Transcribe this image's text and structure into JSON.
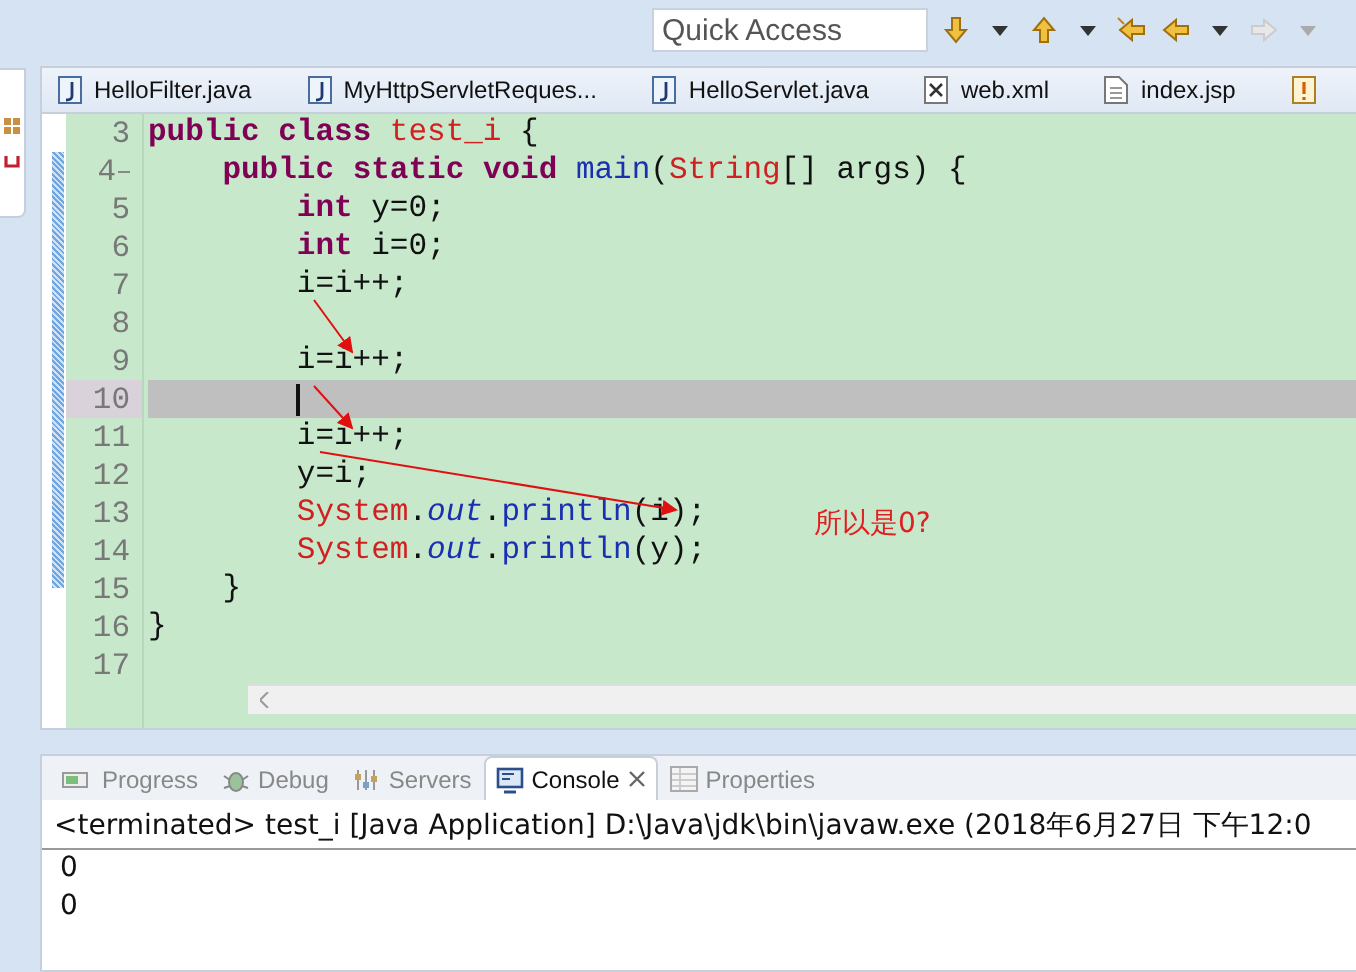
{
  "toolbar": {
    "quick_access": {
      "placeholder": "Quick Access"
    }
  },
  "editor": {
    "tabs": [
      {
        "label": "HelloFilter.java",
        "kind": "java",
        "selected": false
      },
      {
        "label": "MyHttpServletReques...",
        "kind": "java",
        "selected": false
      },
      {
        "label": "HelloServlet.java",
        "kind": "java",
        "selected": false
      },
      {
        "label": "web.xml",
        "kind": "xml",
        "selected": false
      },
      {
        "label": "index.jsp",
        "kind": "file",
        "selected": false
      },
      {
        "kind": "warning",
        "selected": false
      }
    ],
    "lines": [
      {
        "number": "3",
        "selected": false,
        "tokens": [
          {
            "kind": "keyword",
            "text": "public"
          },
          {
            "kind": "keyword",
            "text": " class"
          },
          {
            "kind": "type",
            "text": " test_i"
          },
          {
            "kind": "plain",
            "text": " {"
          }
        ],
        "children": [
          {
            "number": "4",
            "selected": false,
            "folding": true,
            "tokens": [
              {
                "kind": "keyword",
                "text": "public"
              },
              {
                "kind": "keyword",
                "text": " static"
              },
              {
                "kind": "keyword",
                "text": " void"
              },
              {
                "kind": "method",
                "text": " main"
              },
              {
                "kind": "plain",
                "text": "("
              },
              {
                "kind": "type",
                "text": "String"
              },
              {
                "kind": "plain",
                "text": "[] args) {"
              }
            ],
            "children": [
              {
                "number": "5",
                "selected": false,
                "tokens": [
                  {
                    "kind": "keyword",
                    "text": "int"
                  },
                  {
                    "kind": "plain",
                    "text": " y=0;"
                  }
                ]
              },
              {
                "number": "6",
                "selected": false,
                "tokens": [
                  {
                    "kind": "keyword",
                    "text": "int"
                  },
                  {
                    "kind": "plain",
                    "text": " i=0;"
                  }
                ]
              },
              {
                "number": "7",
                "selected": false,
                "tokens": [
                  {
                    "kind": "plain",
                    "text": "i=i++;"
                  }
                ]
              },
              {
                "number": "8",
                "selected": false
              },
              {
                "number": "9",
                "selected": false,
                "tokens": [
                  {
                    "kind": "plain",
                    "text": "i=i++;"
                  }
                ]
              },
              {
                "number": "10",
                "selected": true
              },
              {
                "number": "11",
                "selected": false,
                "tokens": [
                  {
                    "kind": "plain",
                    "text": "i=i++;"
                  }
                ]
              },
              {
                "number": "12",
                "selected": false,
                "tokens": [
                  {
                    "kind": "plain",
                    "text": "y=i;"
                  }
                ]
              },
              {
                "number": "13",
                "selected": false,
                "tokens": [
                  {
                    "kind": "type",
                    "text": "System"
                  },
                  {
                    "kind": "plain",
                    "text": "."
                  },
                  {
                    "kind": "static",
                    "text": "out"
                  },
                  {
                    "kind": "plain",
                    "text": "."
                  },
                  {
                    "kind": "method",
                    "text": "println"
                  },
                  {
                    "kind": "plain",
                    "text": "(i);"
                  }
                ]
              },
              {
                "number": "14",
                "selected": false,
                "tokens": [
                  {
                    "kind": "type",
                    "text": "System"
                  },
                  {
                    "kind": "plain",
                    "text": "."
                  },
                  {
                    "kind": "static",
                    "text": "out"
                  },
                  {
                    "kind": "plain",
                    "text": "."
                  },
                  {
                    "kind": "method",
                    "text": "println"
                  },
                  {
                    "kind": "plain",
                    "text": "(y);"
                  }
                ]
              }
            ]
          },
          {
            "number": "15",
            "selected": false,
            "tokens": [
              {
                "kind": "plain",
                "text": "}"
              }
            ]
          }
        ]
      },
      {
        "number": "16",
        "selected": false,
        "tokens": [
          {
            "kind": "plain",
            "text": "}"
          }
        ]
      },
      {
        "number": "17",
        "selected": false
      }
    ],
    "annotation": "所以是0?"
  },
  "console": {
    "tabs": [
      {
        "label": "Progress",
        "kind": "progress",
        "selected": false
      },
      {
        "label": "Debug",
        "kind": "debug",
        "selected": false
      },
      {
        "label": "Servers",
        "kind": "servers",
        "selected": false
      },
      {
        "label": "Console",
        "kind": "console",
        "selected": true
      },
      {
        "label": "Properties",
        "kind": "properties",
        "selected": false
      }
    ],
    "header": "<terminated> test_i [Java Application] D:\\Java\\jdk\\bin\\javaw.exe (2018年6月27日 下午12:0",
    "output": [
      "0",
      "0"
    ]
  }
}
